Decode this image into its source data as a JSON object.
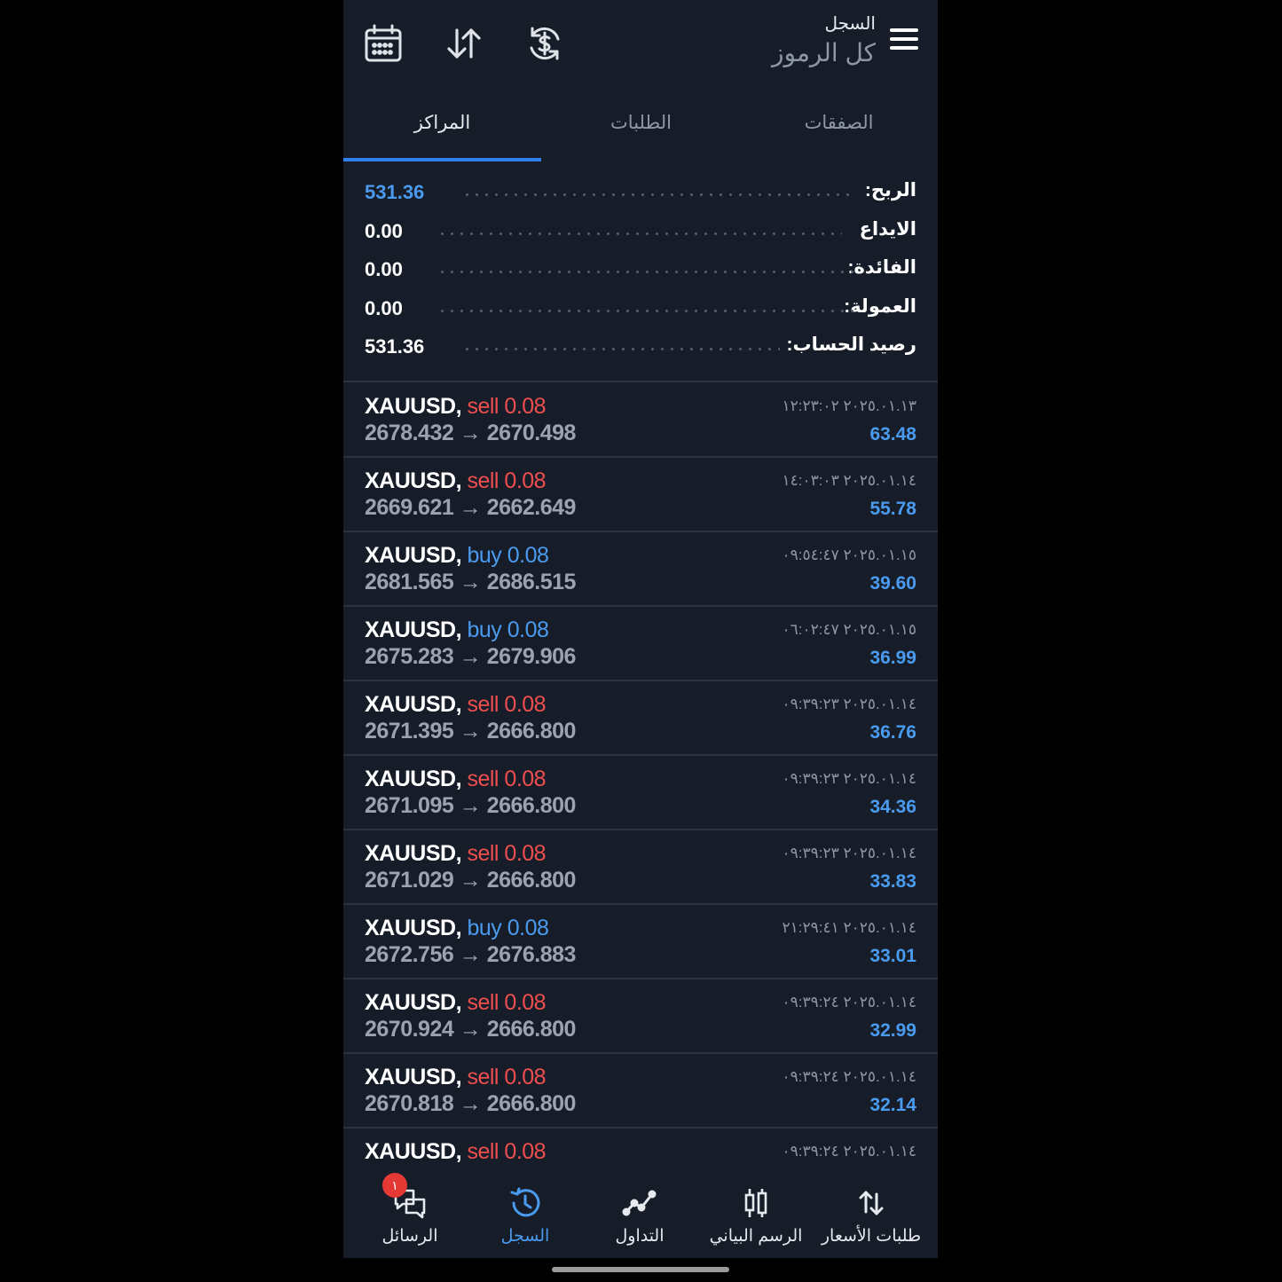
{
  "header": {
    "title_small": "السجل",
    "title_big": "كل الرموز",
    "icons": [
      "calendar-icon",
      "sort-icon",
      "currency-refresh-icon",
      "menu-icon"
    ]
  },
  "tabs": [
    {
      "label": "الصفقات",
      "active": false
    },
    {
      "label": "الطلبات",
      "active": false
    },
    {
      "label": "المراكز",
      "active": true
    }
  ],
  "summary": [
    {
      "label": "الربح:",
      "value": "531.36",
      "highlight": true
    },
    {
      "label": "الايداع",
      "value": "0.00",
      "highlight": false
    },
    {
      "label": "الفائدة:",
      "value": "0.00",
      "highlight": false
    },
    {
      "label": "العمولة:",
      "value": "0.00",
      "highlight": false
    },
    {
      "label": "رصيد الحساب:",
      "value": "531.36",
      "highlight": false
    }
  ],
  "deals": [
    {
      "symbol": "XAUUSD,",
      "type": "sell 0.08",
      "side": "sell",
      "open": "2678.432",
      "close": "2670.498",
      "arrow": "→",
      "date": "٢٠٢٥.٠١.١٣ ١٢:٢٣:٠٢",
      "profit": "63.48"
    },
    {
      "symbol": "XAUUSD,",
      "type": "sell 0.08",
      "side": "sell",
      "open": "2669.621",
      "close": "2662.649",
      "arrow": "→",
      "date": "٢٠٢٥.٠١.١٤ ١٤:٠٣:٠٣",
      "profit": "55.78"
    },
    {
      "symbol": "XAUUSD,",
      "type": "buy 0.08",
      "side": "buy",
      "open": "2681.565",
      "close": "2686.515",
      "arrow": "→",
      "date": "٢٠٢٥.٠١.١٥ ٠٩:٥٤:٤٧",
      "profit": "39.60"
    },
    {
      "symbol": "XAUUSD,",
      "type": "buy 0.08",
      "side": "buy",
      "open": "2675.283",
      "close": "2679.906",
      "arrow": "→",
      "date": "٢٠٢٥.٠١.١٥ ٠٦:٠٢:٤٧",
      "profit": "36.99"
    },
    {
      "symbol": "XAUUSD,",
      "type": "sell 0.08",
      "side": "sell",
      "open": "2671.395",
      "close": "2666.800",
      "arrow": "→",
      "date": "٢٠٢٥.٠١.١٤ ٠٩:٣٩:٢٣",
      "profit": "36.76"
    },
    {
      "symbol": "XAUUSD,",
      "type": "sell 0.08",
      "side": "sell",
      "open": "2671.095",
      "close": "2666.800",
      "arrow": "→",
      "date": "٢٠٢٥.٠١.١٤ ٠٩:٣٩:٢٣",
      "profit": "34.36"
    },
    {
      "symbol": "XAUUSD,",
      "type": "sell 0.08",
      "side": "sell",
      "open": "2671.029",
      "close": "2666.800",
      "arrow": "→",
      "date": "٢٠٢٥.٠١.١٤ ٠٩:٣٩:٢٣",
      "profit": "33.83"
    },
    {
      "symbol": "XAUUSD,",
      "type": "buy 0.08",
      "side": "buy",
      "open": "2672.756",
      "close": "2676.883",
      "arrow": "→",
      "date": "٢٠٢٥.٠١.١٤ ٢١:٢٩:٤١",
      "profit": "33.01"
    },
    {
      "symbol": "XAUUSD,",
      "type": "sell 0.08",
      "side": "sell",
      "open": "2670.924",
      "close": "2666.800",
      "arrow": "→",
      "date": "٢٠٢٥.٠١.١٤ ٠٩:٣٩:٢٤",
      "profit": "32.99"
    },
    {
      "symbol": "XAUUSD,",
      "type": "sell 0.08",
      "side": "sell",
      "open": "2670.818",
      "close": "2666.800",
      "arrow": "→",
      "date": "٢٠٢٥.٠١.١٤ ٠٩:٣٩:٢٤",
      "profit": "32.14"
    },
    {
      "symbol": "XAUUSD,",
      "type": "sell 0.08",
      "side": "sell",
      "open": "",
      "close": "",
      "arrow": "",
      "date": "٢٠٢٥.٠١.١٤ ٠٩:٣٩:٢٤",
      "profit": ""
    }
  ],
  "bottom_nav": [
    {
      "label": "الرسائل",
      "icon": "messages-icon",
      "badge": "١",
      "active": false
    },
    {
      "label": "السجل",
      "icon": "history-icon",
      "badge": "",
      "active": true
    },
    {
      "label": "التداول",
      "icon": "trade-icon",
      "badge": "",
      "active": false
    },
    {
      "label": "الرسم البياني",
      "icon": "candlestick-chart-icon",
      "badge": "",
      "active": false
    },
    {
      "label": "طلبات الأسعار",
      "icon": "quotes-icon",
      "badge": "",
      "active": false
    }
  ],
  "colors": {
    "background": "#161d29",
    "accent": "#4a9bf0",
    "sell": "#ef4e4e",
    "text": "#ffffff",
    "muted": "#8e97a4"
  }
}
